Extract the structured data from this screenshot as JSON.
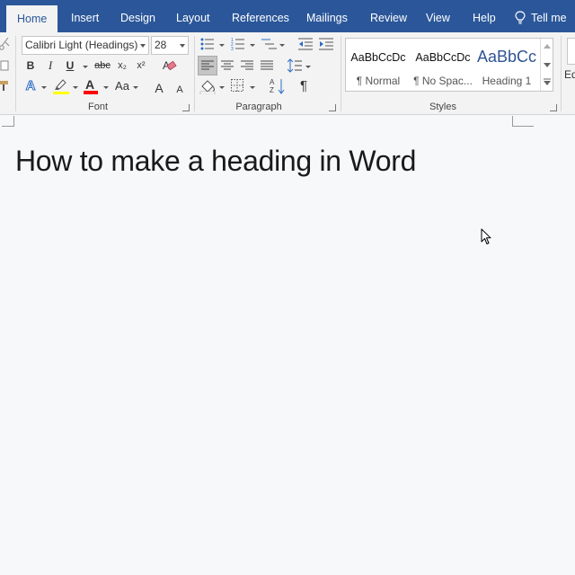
{
  "tabs": [
    {
      "label": "Home",
      "active": true
    },
    {
      "label": "Insert"
    },
    {
      "label": "Design"
    },
    {
      "label": "Layout"
    },
    {
      "label": "References"
    },
    {
      "label": "Mailings"
    },
    {
      "label": "Review"
    },
    {
      "label": "View"
    },
    {
      "label": "Help"
    },
    {
      "label": "Tell me"
    }
  ],
  "ribbon": {
    "font": {
      "group_label": "Font",
      "font_name": "Calibri Light (Headings)",
      "font_size": "28",
      "bold": "B",
      "italic": "I",
      "underline": "U",
      "strikethrough": "abc",
      "subscript": "x₂",
      "superscript": "x²",
      "text_effects": "A",
      "font_color": "A",
      "change_case": "Aa",
      "grow": "A",
      "shrink": "A"
    },
    "paragraph": {
      "group_label": "Paragraph",
      "pilcrow": "¶"
    },
    "styles": {
      "group_label": "Styles",
      "items": [
        {
          "sample": "AaBbCcDc",
          "name": "¶ Normal"
        },
        {
          "sample": "AaBbCcDc",
          "name": "¶ No Spac..."
        },
        {
          "sample": "AaBbCc",
          "name": "Heading 1"
        }
      ]
    },
    "editing": {
      "label": "Ed"
    }
  },
  "document": {
    "heading": "How to make a heading in Word"
  },
  "colors": {
    "tabbar": "#2b579a",
    "heading_style": "#2f5496",
    "highlight": "#ffff00",
    "font_color": "#ff0000"
  }
}
